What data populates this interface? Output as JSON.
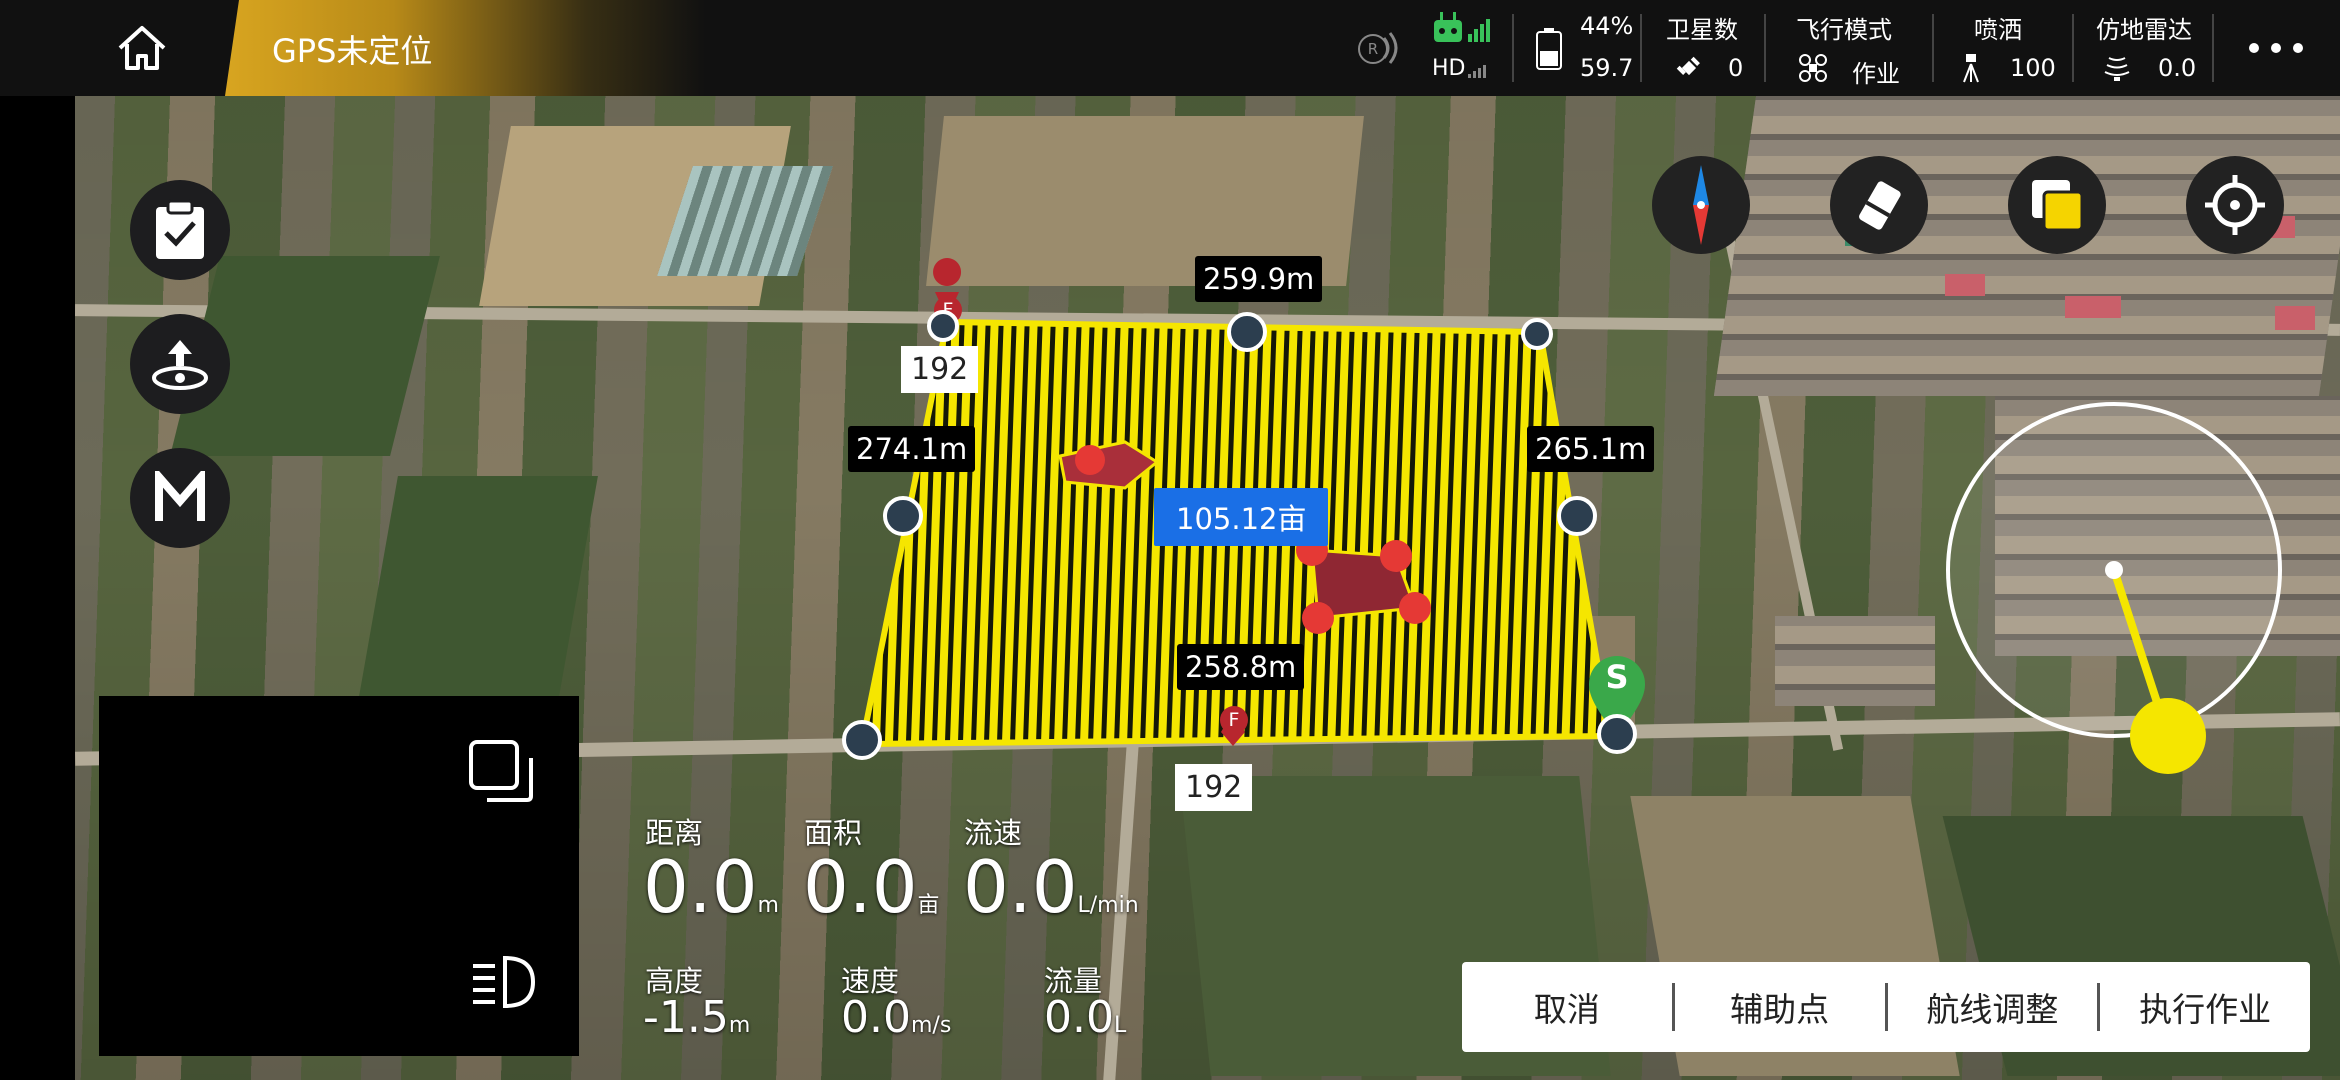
{
  "status": {
    "gps_text": "GPS未定位",
    "signal_hd": "HD",
    "battery_percent": "44%",
    "battery_voltage": "59.7",
    "satellites_label": "卫星数",
    "satellites_value": "0",
    "flight_mode_label": "飞行模式",
    "flight_mode_value": "作业",
    "spray_label": "喷洒",
    "spray_value": "100",
    "radar_label": "仿地雷达",
    "radar_value": "0.0"
  },
  "map": {
    "edge_top": "259.9m",
    "edge_left": "274.1m",
    "edge_right": "265.1m",
    "edge_bottom": "258.8m",
    "area": "105.12亩",
    "alt_tag_top": "192",
    "alt_tag_bottom": "192",
    "marker_f": "F",
    "marker_s": "S"
  },
  "telemetry": {
    "distance_label": "距离",
    "distance_value": "0.0",
    "distance_unit": "m",
    "area_label": "面积",
    "area_value": "0.0",
    "area_unit": "亩",
    "flow_rate_label": "流速",
    "flow_rate_value": "0.0",
    "flow_rate_unit": "L/min",
    "height_label": "高度",
    "height_value": "-1.5",
    "height_unit": "m",
    "speed_label": "速度",
    "speed_value": "0.0",
    "speed_unit": "m/s",
    "volume_label": "流量",
    "volume_value": "0.0",
    "volume_unit": "L"
  },
  "actions": {
    "cancel": "取消",
    "aux_point": "辅助点",
    "route_adjust": "航线调整",
    "execute": "执行作业"
  },
  "colors": {
    "accent_yellow": "#f5e600",
    "area_blue": "#1a6fe6",
    "obstacle_red": "#e53935",
    "start_green": "#3aa84a"
  }
}
